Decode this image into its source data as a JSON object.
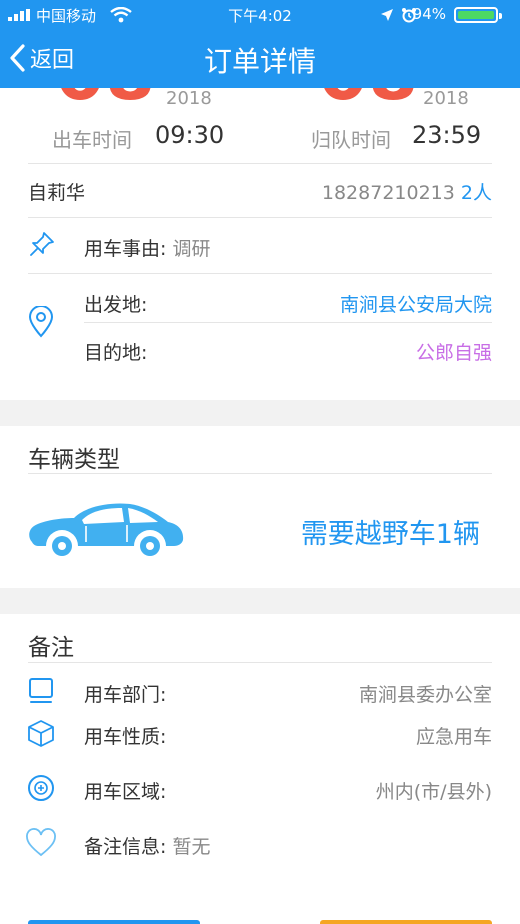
{
  "status": {
    "carrier": "中国移动",
    "time": "下午4:02",
    "battery": "94%"
  },
  "nav": {
    "back_label": "返回",
    "title": "订单详情"
  },
  "trip": {
    "depart_year": "2018",
    "return_year": "2018",
    "depart_label": "出车时间",
    "depart_time": "09:30",
    "return_label": "归队时间",
    "return_time": "23:59",
    "passenger_name": "自莉华",
    "phone": "18287210213",
    "people_count": "2人",
    "reason_label": "用车事由:",
    "reason_value": "调研",
    "origin_label": "出发地:",
    "origin_value": "南涧县公安局大院",
    "dest_label": "目的地:",
    "dest_value": "公郎自强"
  },
  "vehicle": {
    "section_title": "车辆类型",
    "requirement": "需要越野车1辆"
  },
  "notes": {
    "section_title": "备注",
    "dept_label": "用车部门:",
    "dept_value": "南涧县委办公室",
    "nature_label": "用车性质:",
    "nature_value": "应急用车",
    "area_label": "用车区域:",
    "area_value": "州内(市/县外)",
    "remark_label": "备注信息:",
    "remark_value": "暂无"
  },
  "colors": {
    "brand_blue": "#2196f0",
    "date_red": "#f05a46",
    "destination_purple": "#c86ee6"
  }
}
